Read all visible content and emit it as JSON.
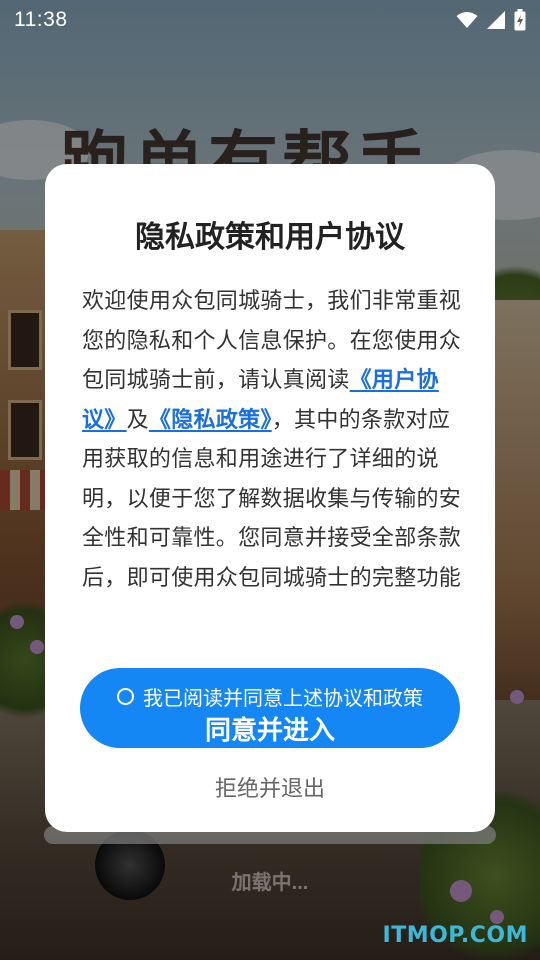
{
  "status_bar": {
    "time": "11:38",
    "icons": [
      "wifi-icon",
      "signal-icon",
      "battery-charging-icon"
    ]
  },
  "background": {
    "app_title": "跑单有帮手",
    "loading_text": "加载中...",
    "watermark": "ITMOP.COM",
    "watermark_color": "#3fb8d8"
  },
  "dialog": {
    "title": "隐私政策和用户协议",
    "body_part1": "欢迎使用众包同城骑士，我们非常重视您的隐私和个人信息保护。在您使用众包同城骑士前，请认真阅读",
    "link_user_agreement": "《用户协议》",
    "body_part2": "及",
    "link_privacy_policy": "《隐私政策》",
    "body_part3": "，其中的条款对应用获取的信息和用途进行了详细的说明，以便于您了解数据收集与传输的安全性和可靠性。您同意并接受全部条款后，即可使用众包同城骑士的完整功能",
    "agree_checkbox_label": "我已阅读并同意上述协议和政策",
    "agree_checked": false,
    "agree_button": "同意并进入",
    "reject_button": "拒绝并退出",
    "accent_color": "#1487f5",
    "link_color": "#1a6fe0"
  }
}
